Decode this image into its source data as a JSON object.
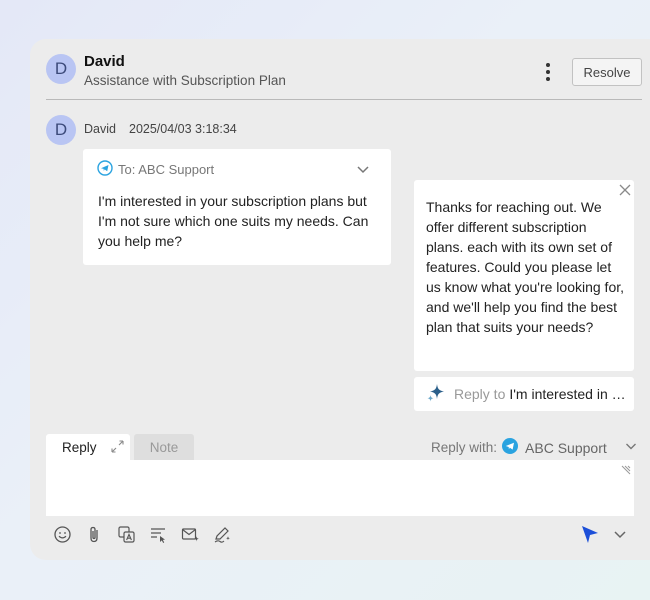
{
  "header": {
    "avatar_initial": "D",
    "name": "David",
    "subtitle": "Assistance with Subscription Plan",
    "resolve_label": "Resolve"
  },
  "message": {
    "avatar_initial": "D",
    "sender": "David",
    "timestamp": "2025/04/03 3:18:34",
    "to_line": "To: ABC Support",
    "body": "I'm interested in your subscription plans but I'm not sure which one suits my needs. Can you help me?"
  },
  "ai_suggestion": {
    "body": "Thanks for reaching out. We offer different subscription plans. each with its own set of features. Could you please let us know what you're looking for, and we'll help you find the best plan that suits your needs?",
    "reply_to_label": "Reply to",
    "reply_to_text": "I'm interested in your subscription plans but I'm not sure which one suits my needs."
  },
  "composer": {
    "tabs": [
      "Reply",
      "Note"
    ],
    "reply_with_label": "Reply with:",
    "reply_with_value": "ABC Support",
    "toolbar_icons": [
      "emoji-icon",
      "attachment-icon",
      "translate-icon",
      "text-format-icon",
      "email-ai-icon",
      "signature-icon"
    ],
    "send_icon": "send-icon"
  },
  "colors": {
    "accent": "#1c4fd8",
    "telegram": "#2aa3e0",
    "avatar_bg": "#b9c5f3",
    "panel_bg": "#ececec"
  }
}
